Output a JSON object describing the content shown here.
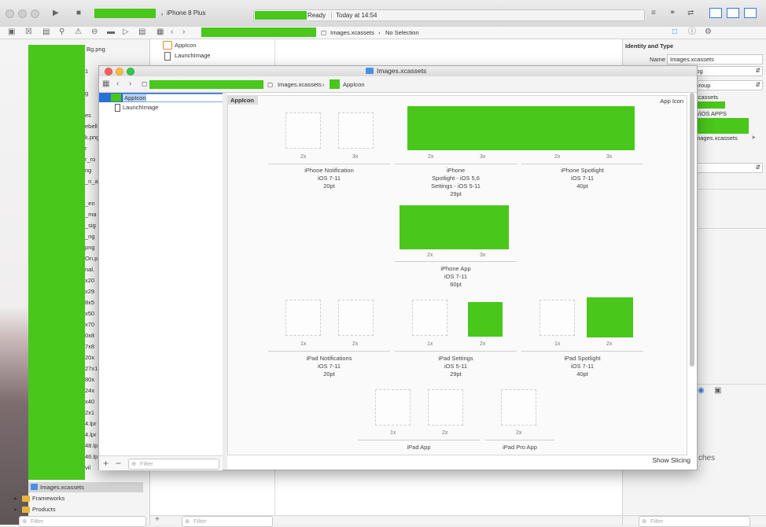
{
  "toolbar": {
    "scheme_device": "iPhone 8 Plus",
    "status_state": "Ready",
    "status_time": "Today at 14:54"
  },
  "jumpbar": {
    "file": "Images.xcassets",
    "selection": "No Selection"
  },
  "editor_list": {
    "items": [
      "AppIcon",
      "LaunchImage"
    ]
  },
  "navigator": {
    "file_fragments": [
      "Bg.png",
      "1",
      "g",
      "es",
      "ebell",
      "k.png",
      "r",
      "r_ro",
      "ng",
      "_n_a",
      "_en",
      "_ma",
      "_sig",
      "_ng",
      "png",
      "On.p",
      "nal.",
      "x20",
      "x29",
      "8x5",
      "x50",
      "x70",
      "0x8",
      "7x8",
      "20x",
      "27x1",
      "80x",
      "24x",
      "x40",
      "2x1",
      "4.lpr",
      "4.lpr",
      "48.lp",
      "46.lp",
      "vil"
    ],
    "selected": "Images.xcassets",
    "folders": [
      "Frameworks",
      "Products"
    ],
    "filter_placeholder": "Filter"
  },
  "inspector": {
    "section_title": "Identity and Type",
    "name_label": "Name",
    "name_value": "Images.xcassets",
    "type_value": "Asset Catalog",
    "location_value": "Relative to Group",
    "path_fragments": [
      "xcassets",
      "s/iOS APPS",
      "mages.xcassets"
    ],
    "bottom_fragment": "ches"
  },
  "asset_window": {
    "title": "Images.xcassets",
    "breadcrumb_catalog": "Images.xcassets",
    "breadcrumb_item": "AppIcon",
    "sidebar_items": [
      "AppIcon",
      "LaunchImage"
    ],
    "filter_placeholder": "Filter",
    "set_name": "AppIcon",
    "set_type": "App Icon",
    "show_slicing": "Show Slicing",
    "groups": [
      {
        "lines": [
          "iPhone Notification",
          "iOS 7-11",
          "20pt"
        ],
        "scales": [
          "2x",
          "3x"
        ]
      },
      {
        "lines": [
          "iPhone",
          "Spotlight - iOS 5,6",
          "Settings - iOS 5-11",
          "29pt"
        ],
        "scales": [
          "2x",
          "3x"
        ]
      },
      {
        "lines": [
          "iPhone Spotlight",
          "iOS 7-11",
          "40pt"
        ],
        "scales": [
          "2x",
          "3x"
        ]
      },
      {
        "lines": [
          "iPhone App",
          "iOS 7-11",
          "60pt"
        ],
        "scales": [
          "2x",
          "3x"
        ]
      },
      {
        "lines": [
          "iPad Notifications",
          "iOS 7-11",
          "20pt"
        ],
        "scales": [
          "1x",
          "2x"
        ]
      },
      {
        "lines": [
          "iPad Settings",
          "iOS 5-11",
          "29pt"
        ],
        "scales": [
          "1x",
          "2x"
        ]
      },
      {
        "lines": [
          "iPad Spotlight",
          "iOS 7-11",
          "40pt"
        ],
        "scales": [
          "1x",
          "2x"
        ]
      },
      {
        "lines": [
          "iPad App"
        ],
        "scales": [
          "1x",
          "2x"
        ]
      },
      {
        "lines": [
          "iPad Pro App"
        ],
        "scales": [
          "2x"
        ]
      }
    ]
  },
  "colors": {
    "redaction": "#49c71b",
    "selection": "#2a6fd6"
  }
}
